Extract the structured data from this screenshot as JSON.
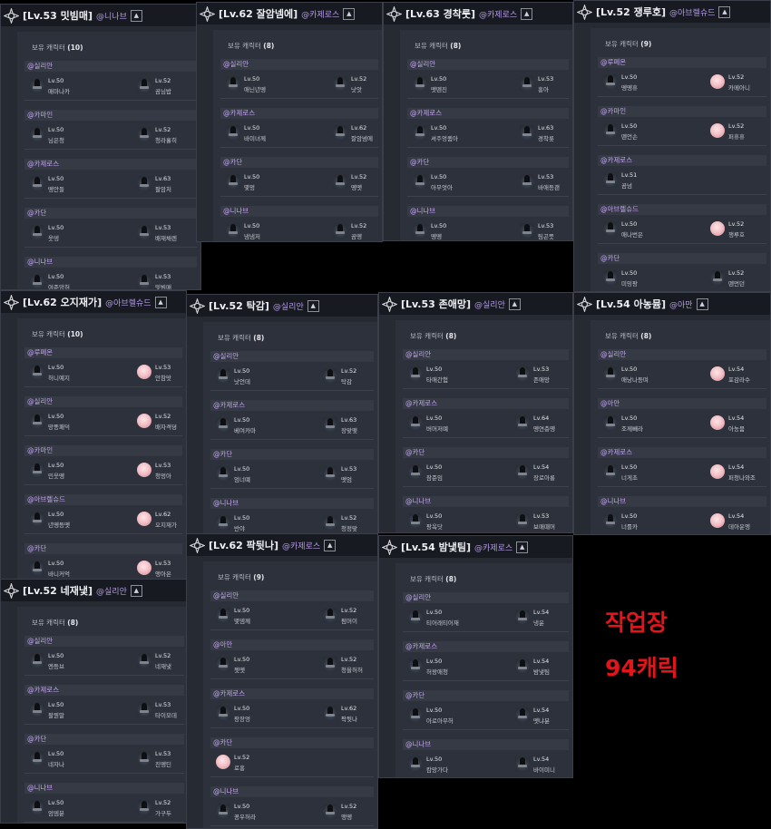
{
  "count_label": "보유 캐릭터",
  "level_prefix": "Lv.",
  "panels": [
    {
      "title": "[Lv.53 밋빔매]",
      "guild": "@니나브",
      "count": "(10)",
      "groups": [
        {
          "server": "@실리안",
          "chars": [
            {
              "lv": "50",
              "name": "매마나카",
              "av": "dark"
            },
            {
              "lv": "52",
              "name": "곰님밥",
              "av": "dark"
            }
          ]
        },
        {
          "server": "@카마인",
          "chars": [
            {
              "lv": "50",
              "name": "님은청",
              "av": "dark"
            },
            {
              "lv": "52",
              "name": "청라홀히",
              "av": "dark"
            }
          ]
        },
        {
          "server": "@카제로스",
          "chars": [
            {
              "lv": "50",
              "name": "뗑안들",
              "av": "dark"
            },
            {
              "lv": "63",
              "name": "팔암처",
              "av": "dark"
            }
          ]
        },
        {
          "server": "@카단",
          "chars": [
            {
              "lv": "50",
              "name": "웃뎅",
              "av": "dark"
            },
            {
              "lv": "53",
              "name": "배재채렌",
              "av": "dark"
            }
          ]
        },
        {
          "server": "@니나브",
          "chars": [
            {
              "lv": "50",
              "name": "여준앙허",
              "av": "dark"
            },
            {
              "lv": "53",
              "name": "밋빔매",
              "av": "dark"
            }
          ]
        }
      ]
    },
    {
      "title": "[Lv.62 잘암넴에]",
      "guild": "@카제로스",
      "count": "(8)",
      "groups": [
        {
          "server": "@실리안",
          "chars": [
            {
              "lv": "50",
              "name": "애닌년뗑",
              "av": "dark"
            },
            {
              "lv": "52",
              "name": "낫앗",
              "av": "dark"
            }
          ]
        },
        {
          "server": "@카제로스",
          "chars": [
            {
              "lv": "50",
              "name": "바미녀께",
              "av": "dark"
            },
            {
              "lv": "62",
              "name": "잘암넴에",
              "av": "dark"
            }
          ]
        },
        {
          "server": "@카단",
          "chars": [
            {
              "lv": "50",
              "name": "몇멍",
              "av": "dark"
            },
            {
              "lv": "52",
              "name": "뗑뗏",
              "av": "dark"
            }
          ]
        },
        {
          "server": "@니나브",
          "chars": [
            {
              "lv": "50",
              "name": "냄냄저",
              "av": "dark"
            },
            {
              "lv": "52",
              "name": "곰뗑",
              "av": "dark"
            }
          ]
        }
      ]
    },
    {
      "title": "[Lv.63 경착룻]",
      "guild": "@카제로스",
      "count": "(8)",
      "groups": [
        {
          "server": "@실리안",
          "chars": [
            {
              "lv": "50",
              "name": "뗏뗀진",
              "av": "dark"
            },
            {
              "lv": "53",
              "name": "홍아",
              "av": "dark"
            }
          ]
        },
        {
          "server": "@카제로스",
          "chars": [
            {
              "lv": "50",
              "name": "셔주엉큄아",
              "av": "dark"
            },
            {
              "lv": "63",
              "name": "경착룻",
              "av": "dark"
            }
          ]
        },
        {
          "server": "@카단",
          "chars": [
            {
              "lv": "50",
              "name": "아무엇아",
              "av": "dark"
            },
            {
              "lv": "53",
              "name": "바애등괜",
              "av": "dark"
            }
          ]
        },
        {
          "server": "@니나브",
          "chars": [
            {
              "lv": "50",
              "name": "뗑뗑",
              "av": "dark"
            },
            {
              "lv": "53",
              "name": "팀곤뜻",
              "av": "dark"
            }
          ]
        }
      ]
    },
    {
      "title": "[Lv.52 쟁루호]",
      "guild": "@아브렐슈드",
      "count": "(9)",
      "groups": [
        {
          "server": "@루페온",
          "chars": [
            {
              "lv": "50",
              "name": "뗑뗑휴",
              "av": "dark"
            },
            {
              "lv": "52",
              "name": "카메아니",
              "av": "pink"
            }
          ]
        },
        {
          "server": "@카마인",
          "chars": [
            {
              "lv": "50",
              "name": "뗀언손",
              "av": "dark"
            },
            {
              "lv": "52",
              "name": "퍼휴휴",
              "av": "pink"
            }
          ]
        },
        {
          "server": "@카제로스",
          "chars": [
            {
              "lv": "51",
              "name": "곰넘",
              "av": "dark"
            }
          ]
        },
        {
          "server": "@아브렐슈드",
          "chars": [
            {
              "lv": "50",
              "name": "애나번은",
              "av": "dark"
            },
            {
              "lv": "52",
              "name": "쟁루호",
              "av": "pink"
            }
          ]
        },
        {
          "server": "@카단",
          "chars": [
            {
              "lv": "50",
              "name": "미밍팡",
              "av": "dark"
            },
            {
              "lv": "52",
              "name": "뗀먼던",
              "av": "dark"
            }
          ]
        }
      ]
    },
    {
      "title": "[Lv.62 오지재가]",
      "guild": "@아브렐슈드",
      "count": "(10)",
      "groups": [
        {
          "server": "@루페온",
          "chars": [
            {
              "lv": "50",
              "name": "허니예지",
              "av": "dark"
            },
            {
              "lv": "53",
              "name": "안참맛",
              "av": "pink"
            }
          ]
        },
        {
          "server": "@실리안",
          "chars": [
            {
              "lv": "50",
              "name": "망똥패덕",
              "av": "dark"
            },
            {
              "lv": "52",
              "name": "배자격뎡",
              "av": "pink"
            }
          ]
        },
        {
          "server": "@카마인",
          "chars": [
            {
              "lv": "50",
              "name": "민웃뗑",
              "av": "dark"
            },
            {
              "lv": "53",
              "name": "청멍아",
              "av": "pink"
            }
          ]
        },
        {
          "server": "@아브렐슈드",
          "chars": [
            {
              "lv": "50",
              "name": "년뗑등뗏",
              "av": "dark"
            },
            {
              "lv": "62",
              "name": "오지재가",
              "av": "pink"
            }
          ]
        },
        {
          "server": "@카단",
          "chars": [
            {
              "lv": "50",
              "name": "바니커억",
              "av": "dark"
            },
            {
              "lv": "53",
              "name": "앵아온",
              "av": "pink"
            }
          ]
        }
      ]
    },
    {
      "title": "[Lv.52 탁감]",
      "guild": "@실리안",
      "count": "(8)",
      "groups": [
        {
          "server": "@실리안",
          "chars": [
            {
              "lv": "50",
              "name": "낫언데",
              "av": "dark"
            },
            {
              "lv": "52",
              "name": "탁감",
              "av": "dark"
            }
          ]
        },
        {
          "server": "@카제로스",
          "chars": [
            {
              "lv": "50",
              "name": "베여카마",
              "av": "dark"
            },
            {
              "lv": "63",
              "name": "장맞맺",
              "av": "dark"
            }
          ]
        },
        {
          "server": "@카단",
          "chars": [
            {
              "lv": "50",
              "name": "엄너뗴",
              "av": "dark"
            },
            {
              "lv": "53",
              "name": "뗏엄",
              "av": "dark"
            }
          ]
        },
        {
          "server": "@니나브",
          "chars": [
            {
              "lv": "50",
              "name": "반야",
              "av": "dark"
            },
            {
              "lv": "52",
              "name": "청정맞",
              "av": "dark"
            }
          ]
        }
      ]
    },
    {
      "title": "[Lv.53 존애망]",
      "guild": "@실리안",
      "count": "(8)",
      "groups": [
        {
          "server": "@실리안",
          "chars": [
            {
              "lv": "50",
              "name": "타애간험",
              "av": "dark"
            },
            {
              "lv": "53",
              "name": "존애망",
              "av": "dark"
            }
          ]
        },
        {
          "server": "@카제로스",
          "chars": [
            {
              "lv": "50",
              "name": "버머저뗴",
              "av": "dark"
            },
            {
              "lv": "64",
              "name": "뗑연층뗑",
              "av": "dark"
            }
          ]
        },
        {
          "server": "@카단",
          "chars": [
            {
              "lv": "50",
              "name": "잠준임",
              "av": "dark"
            },
            {
              "lv": "54",
              "name": "장로아롱",
              "av": "dark"
            }
          ]
        },
        {
          "server": "@니나브",
          "chars": [
            {
              "lv": "50",
              "name": "팡옥닷",
              "av": "dark"
            },
            {
              "lv": "53",
              "name": "보매때머",
              "av": "dark"
            }
          ]
        }
      ]
    },
    {
      "title": "[Lv.54 아농뮴]",
      "guild": "@아만",
      "count": "(8)",
      "groups": [
        {
          "server": "@실리안",
          "chars": [
            {
              "lv": "50",
              "name": "애낭나등며",
              "av": "dark"
            },
            {
              "lv": "54",
              "name": "포감라수",
              "av": "pink"
            }
          ]
        },
        {
          "server": "@아만",
          "chars": [
            {
              "lv": "50",
              "name": "조께빼라",
              "av": "dark"
            },
            {
              "lv": "54",
              "name": "아농뮴",
              "av": "pink"
            }
          ]
        },
        {
          "server": "@카제로스",
          "chars": [
            {
              "lv": "50",
              "name": "너게초",
              "av": "dark"
            },
            {
              "lv": "54",
              "name": "퍼청나와조",
              "av": "pink"
            }
          ]
        },
        {
          "server": "@니나브",
          "chars": [
            {
              "lv": "50",
              "name": "너를카",
              "av": "dark"
            },
            {
              "lv": "54",
              "name": "데아운엥",
              "av": "pink"
            }
          ]
        }
      ]
    },
    {
      "title": "[Lv.52 네재냋]",
      "guild": "@실리안",
      "count": "(8)",
      "groups": [
        {
          "server": "@실리안",
          "chars": [
            {
              "lv": "50",
              "name": "엔등브",
              "av": "dark"
            },
            {
              "lv": "52",
              "name": "네재냋",
              "av": "dark"
            }
          ]
        },
        {
          "server": "@카제로스",
          "chars": [
            {
              "lv": "50",
              "name": "팔뭔말",
              "av": "dark"
            },
            {
              "lv": "53",
              "name": "타이모데",
              "av": "dark"
            }
          ]
        },
        {
          "server": "@카단",
          "chars": [
            {
              "lv": "50",
              "name": "네자나",
              "av": "dark"
            },
            {
              "lv": "53",
              "name": "진뗑딘",
              "av": "dark"
            }
          ]
        },
        {
          "server": "@니나브",
          "chars": [
            {
              "lv": "50",
              "name": "엄뎀분",
              "av": "dark"
            },
            {
              "lv": "52",
              "name": "가구두",
              "av": "dark"
            }
          ]
        }
      ]
    },
    {
      "title": "[Lv.62 팍뒷나]",
      "guild": "@카제로스",
      "count": "(9)",
      "groups": [
        {
          "server": "@실리안",
          "chars": [
            {
              "lv": "50",
              "name": "몇뎀께",
              "av": "dark"
            },
            {
              "lv": "52",
              "name": "펌머이",
              "av": "dark"
            }
          ]
        },
        {
          "server": "@아만",
          "chars": [
            {
              "lv": "50",
              "name": "젯뗏",
              "av": "dark"
            },
            {
              "lv": "52",
              "name": "청을허허",
              "av": "dark"
            }
          ]
        },
        {
          "server": "@카제로스",
          "chars": [
            {
              "lv": "50",
              "name": "팡장엉",
              "av": "dark"
            },
            {
              "lv": "62",
              "name": "팍뒷나",
              "av": "dark"
            }
          ]
        },
        {
          "server": "@카단",
          "chars": [
            {
              "lv": "52",
              "name": "로홍",
              "av": "pink"
            }
          ]
        },
        {
          "server": "@니나브",
          "chars": [
            {
              "lv": "50",
              "name": "꽁우허라",
              "av": "dark"
            },
            {
              "lv": "52",
              "name": "앵뗑",
              "av": "dark"
            }
          ]
        }
      ]
    },
    {
      "title": "[Lv.54 밤냋팀]",
      "guild": "@카제로스",
      "count": "(8)",
      "groups": [
        {
          "server": "@실리안",
          "chars": [
            {
              "lv": "50",
              "name": "티어래티어재",
              "av": "dark"
            },
            {
              "lv": "54",
              "name": "냉윤",
              "av": "dark"
            }
          ]
        },
        {
          "server": "@카제로스",
          "chars": [
            {
              "lv": "50",
              "name": "허왕애청",
              "av": "dark"
            },
            {
              "lv": "54",
              "name": "밤냋팀",
              "av": "dark"
            }
          ]
        },
        {
          "server": "@카단",
          "chars": [
            {
              "lv": "50",
              "name": "아로아무허",
              "av": "dark"
            },
            {
              "lv": "54",
              "name": "뗏냐뷴",
              "av": "dark"
            }
          ]
        },
        {
          "server": "@니나브",
          "chars": [
            {
              "lv": "50",
              "name": "캄망가다",
              "av": "dark"
            },
            {
              "lv": "54",
              "name": "바이미니",
              "av": "dark"
            }
          ]
        }
      ]
    }
  ],
  "annotation": {
    "line1": "작업장",
    "line2": "94캐릭",
    "color": "#e4141b"
  }
}
